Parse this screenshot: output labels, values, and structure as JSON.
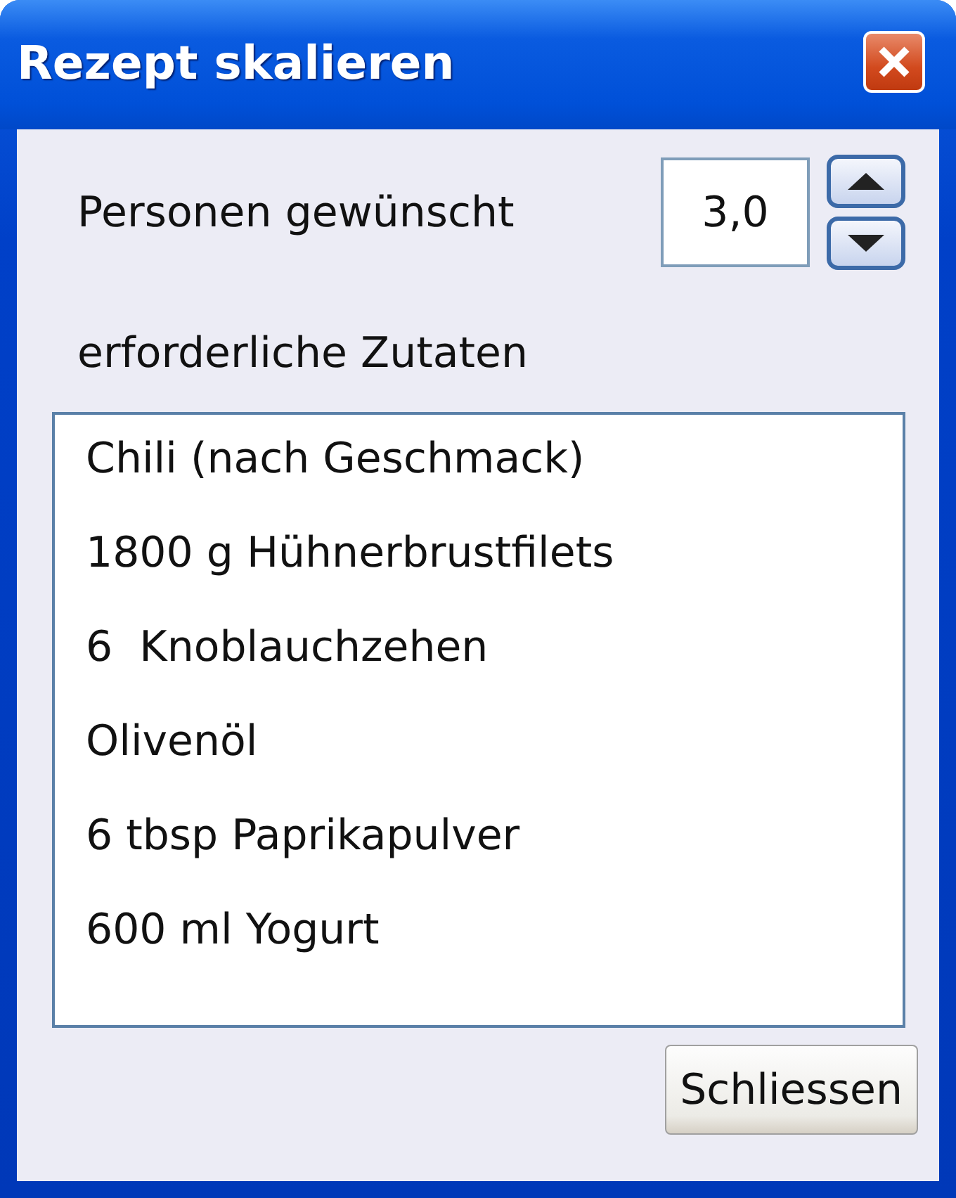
{
  "window": {
    "title": "Rezept skalieren"
  },
  "persons": {
    "label": "Personen gewünscht",
    "value": "3,0"
  },
  "ingredients": {
    "label": "erforderliche Zutaten",
    "items": [
      "Chili (nach Geschmack)",
      "1800 g Hühnerbrustfilets",
      "6  Knoblauchzehen",
      "Olivenöl",
      "6 tbsp Paprikapulver",
      "600 ml Yogurt"
    ]
  },
  "buttons": [
    "Schliessen"
  ]
}
